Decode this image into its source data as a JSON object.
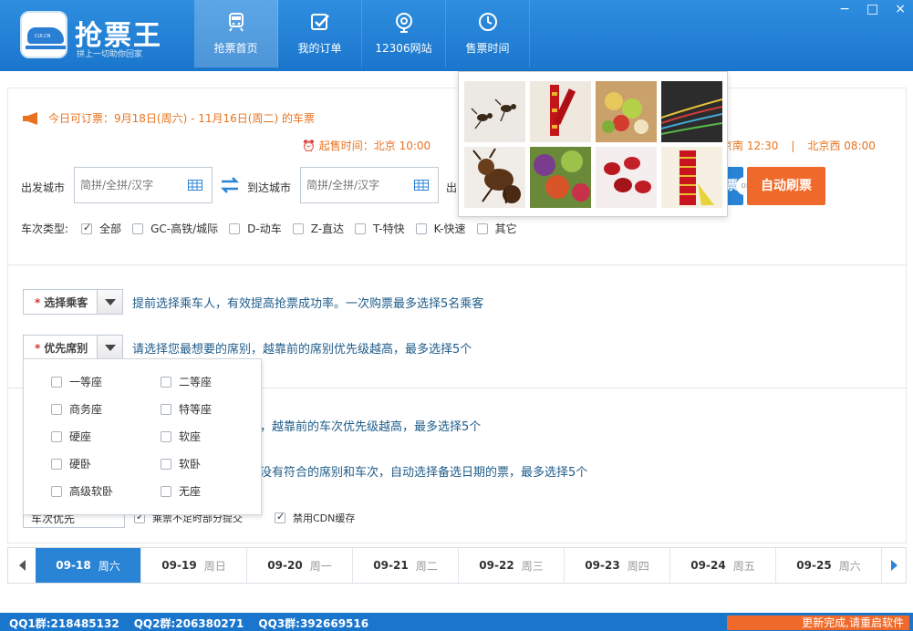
{
  "app": {
    "title": "抢票王",
    "subtitle": "拼上一切助你回家",
    "badge_text": "CUI.CN"
  },
  "window_controls": [
    "−",
    "□",
    "×"
  ],
  "nav": [
    {
      "label": "抢票首页",
      "icon": "train-icon",
      "active": true
    },
    {
      "label": "我的订单",
      "icon": "checkbox-icon",
      "active": false
    },
    {
      "label": "12306网站",
      "icon": "globe-icon",
      "active": false
    },
    {
      "label": "售票时间",
      "icon": "clock-icon",
      "active": false
    }
  ],
  "notice": {
    "text": "今日可订票：9月18日(周六) - 11月16日(周二) 的车票"
  },
  "sale_time": {
    "label": "起售时间：北京 10:00",
    "right_parts": [
      "京南 12:30",
      "|",
      "北京西 08:00"
    ]
  },
  "search": {
    "from_label": "出发城市",
    "from_placeholder": "简拼/全拼/汉字",
    "to_label": "到达城市",
    "to_placeholder": "简拼/全拼/汉字",
    "date_label": "出",
    "query_button": "票",
    "or_text": "or",
    "auto_button": "自动刷票"
  },
  "train_types": {
    "label": "车次类型:",
    "items": [
      {
        "label": "全部",
        "checked": true
      },
      {
        "label": "GC-高铁/城际",
        "checked": false
      },
      {
        "label": "D-动车",
        "checked": false
      },
      {
        "label": "Z-直达",
        "checked": false
      },
      {
        "label": "T-特快",
        "checked": false
      },
      {
        "label": "K-快速",
        "checked": false
      },
      {
        "label": "其它",
        "checked": false
      }
    ]
  },
  "passenger": {
    "star": "*",
    "label": "选择乘客",
    "hint": "提前选择乘车人，有效提高抢票成功率。一次购票最多选择5名乘客"
  },
  "seat_priority": {
    "star": "*",
    "label": "优先席别",
    "hint": "请选择您最想要的席别，越靠前的席别优先级越高，最多选择5个"
  },
  "seats": [
    [
      "一等座",
      "二等座"
    ],
    [
      "商务座",
      "特等座"
    ],
    [
      "硬座",
      "软座"
    ],
    [
      "硬卧",
      "软卧"
    ],
    [
      "高级软卧",
      "无座"
    ]
  ],
  "hidden_hints": {
    "train_hint": "，越靠前的车次优先级越高，最多选择5个",
    "date_hint": "没有符合的席别和车次，自动选择备选日期的票，最多选择5个"
  },
  "options": {
    "mode_select": "车次优先",
    "opt1": "乘票不足时部分提交",
    "opt2": "禁用CDN缓存"
  },
  "dates": [
    {
      "date": "09-18",
      "weekday": "周六",
      "active": true
    },
    {
      "date": "09-19",
      "weekday": "周日",
      "active": false
    },
    {
      "date": "09-20",
      "weekday": "周一",
      "active": false
    },
    {
      "date": "09-21",
      "weekday": "周二",
      "active": false
    },
    {
      "date": "09-22",
      "weekday": "周三",
      "active": false
    },
    {
      "date": "09-23",
      "weekday": "周四",
      "active": false
    },
    {
      "date": "09-24",
      "weekday": "周五",
      "active": false
    },
    {
      "date": "09-25",
      "weekday": "周六",
      "active": false
    }
  ],
  "footer": {
    "qq": [
      "QQ1群:218485132",
      "QQ2群:206380271",
      "QQ3群:392669516"
    ],
    "update": "更新完成,请重启软件"
  },
  "colors": {
    "brand_blue": "#1a76cc",
    "accent_orange": "#ef6a2a",
    "notice_orange": "#e8731f",
    "hint_blue": "#1f5c8a"
  }
}
